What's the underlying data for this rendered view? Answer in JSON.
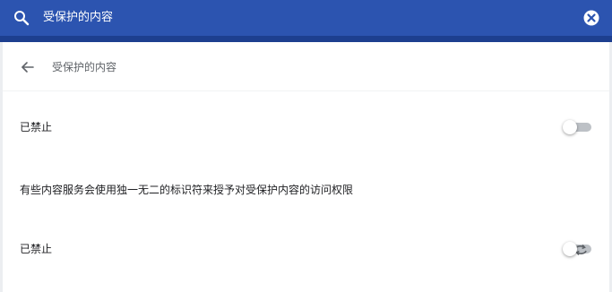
{
  "search": {
    "query": "受保护的内容",
    "search_icon": "search-icon",
    "clear_icon": "close-circle-icon"
  },
  "header": {
    "back_icon": "arrow-left-icon",
    "title": "受保护的内容"
  },
  "settings": {
    "first_row": {
      "label": "已禁止",
      "toggle_on": false
    },
    "description": "有些内容服务会使用独一无二的标识符来授予对受保护内容的访问权限",
    "second_row": {
      "label": "已禁止",
      "toggle_on": false,
      "extra_icon": "sync-icon"
    }
  },
  "colors": {
    "accent": "#2c54b0",
    "accent_dark": "#1d3f8f",
    "page_bg": "#eceef1",
    "card_bg": "#ffffff",
    "toggle_track_off": "#bdc1c6"
  }
}
